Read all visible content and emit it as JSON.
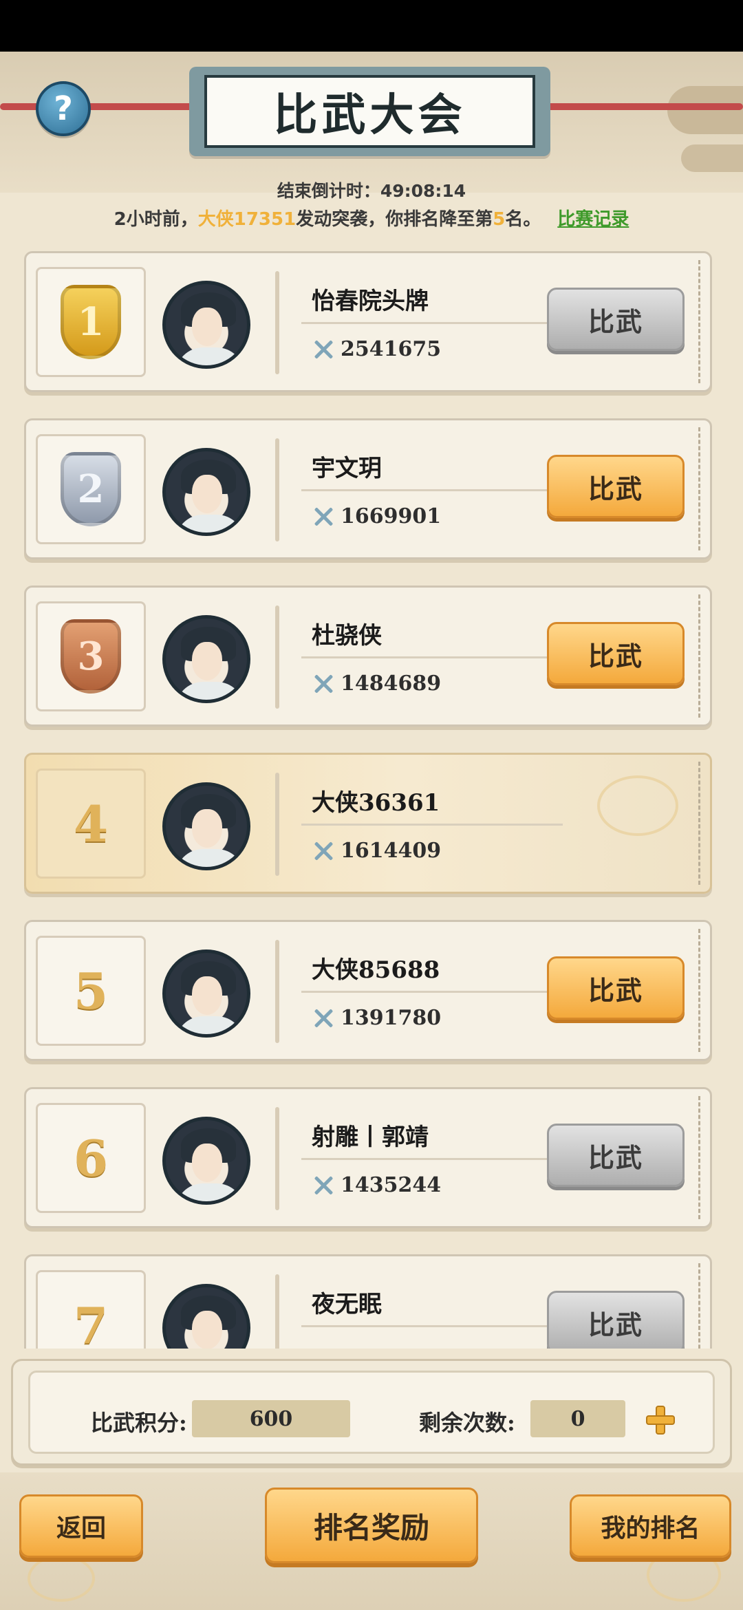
{
  "header": {
    "title": "比武大会",
    "help_symbol": "?",
    "countdown": "结束倒计时：49:08:14",
    "notice": {
      "prefix": "2小时前，",
      "attacker": "大侠17351",
      "middle": "发动突袭，你排名降至第",
      "rank": "5",
      "suffix": "名。",
      "record_link": "比赛记录"
    }
  },
  "fight_label": "比武",
  "players": [
    {
      "rank": "1",
      "medal": "gold",
      "name": "怡春院头牌",
      "power": "2541675",
      "button": "disabled",
      "self": false
    },
    {
      "rank": "2",
      "medal": "silver",
      "name": "宇文玥",
      "power": "1669901",
      "button": "active",
      "self": false
    },
    {
      "rank": "3",
      "medal": "bronze",
      "name": "杜骁侠",
      "power": "1484689",
      "button": "active",
      "self": false
    },
    {
      "rank": "4",
      "medal": "",
      "name": "大侠36361",
      "power": "1614409",
      "button": "none",
      "self": true
    },
    {
      "rank": "5",
      "medal": "",
      "name": "大侠85688",
      "power": "1391780",
      "button": "active",
      "self": false
    },
    {
      "rank": "6",
      "medal": "",
      "name": "射雕丨郭靖",
      "power": "1435244",
      "button": "disabled",
      "self": false
    },
    {
      "rank": "7",
      "medal": "",
      "name": "夜无眠",
      "power": "",
      "button": "disabled",
      "self": false
    }
  ],
  "score": {
    "points_label": "比武积分:",
    "points_value": "600",
    "remaining_label": "剩余次数:",
    "remaining_value": "0"
  },
  "footer": {
    "back": "返回",
    "rewards": "排名奖励",
    "my_rank": "我的排名"
  },
  "colors": {
    "accent_orange": "#f4a93c",
    "highlight_yellow": "#f0b13a",
    "link_green": "#3e9a2a"
  }
}
